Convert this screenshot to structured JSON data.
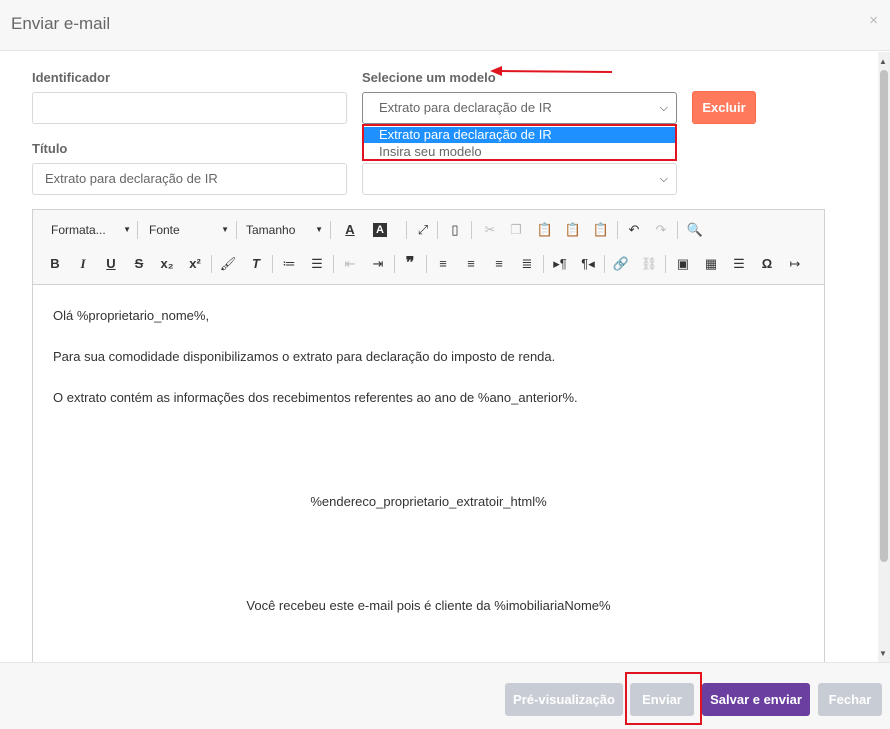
{
  "modal": {
    "title": "Enviar e-mail",
    "close_glyph": "×"
  },
  "form": {
    "identificador_label": "Identificador",
    "identificador_value": "",
    "modelo_label": "Selecione um modelo",
    "modelo_selected": "Extrato para declaração de IR",
    "excluir_label": "Excluir",
    "titulo_label": "Título",
    "titulo_value": "Extrato para declaração de IR",
    "dropdown_options": [
      "Extrato para declaração de IR",
      "Insira seu modelo"
    ]
  },
  "toolbar": {
    "format_label": "Formata...",
    "font_label": "Fonte",
    "size_label": "Tamanho"
  },
  "editor": {
    "lines": [
      "Olá %proprietario_nome%,",
      "Para sua comodidade disponibilizamos o extrato para declaração do imposto de renda.",
      "O extrato contém as informações dos recebimentos referentes ao ano de %ano_anterior%.",
      "%endereco_proprietario_extratoir_html%",
      "Você recebeu este e-mail pois é cliente da %imobiliariaNome%"
    ]
  },
  "footer": {
    "preview_label": "Pré-visualização",
    "send_label": "Enviar",
    "save_send_label": "Salvar e enviar",
    "close_label": "Fechar"
  },
  "colors": {
    "accent_red": "#e0141e",
    "excluir_bg": "#ff7a5c",
    "save_send_bg": "#6a3fa0",
    "selected_option_bg": "#1e90ff"
  }
}
